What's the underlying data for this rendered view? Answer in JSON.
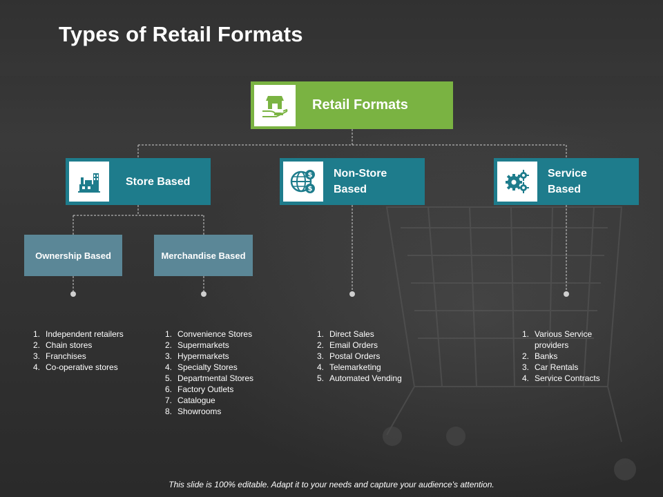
{
  "slide": {
    "title": "Types of Retail Formats",
    "footer": "This slide is 100% editable. Adapt it to your needs and capture your audience's attention."
  },
  "colors": {
    "root_box": "#7ab342",
    "category_box": "#1e7c8c",
    "sub_box": "#5b8797",
    "connector": "#cfcfcf"
  },
  "root": {
    "label": "Retail Formats",
    "icon": "shop-in-hand-icon"
  },
  "categories": [
    {
      "label": "Store Based",
      "icon": "factory-building-icon"
    },
    {
      "label_line1": "Non-Store",
      "label_line2": "Based",
      "icon": "globe-dollar-icon"
    },
    {
      "label_line1": "Service",
      "label_line2": "Based",
      "icon": "gears-icon"
    }
  ],
  "store_subtypes": [
    {
      "label": "Ownership Based"
    },
    {
      "label": "Merchandise Based"
    }
  ],
  "lists": {
    "ownership": [
      {
        "n": "1.",
        "text": "Independent  retailers"
      },
      {
        "n": "2.",
        "text": "Chain stores"
      },
      {
        "n": "3.",
        "text": "Franchises"
      },
      {
        "n": "4.",
        "text": "Co-operative  stores"
      }
    ],
    "merchandise": [
      {
        "n": "1.",
        "text": "Convenience  Stores"
      },
      {
        "n": "2.",
        "text": "Supermarkets"
      },
      {
        "n": "3.",
        "text": "Hypermarkets"
      },
      {
        "n": "4.",
        "text": "Specialty Stores"
      },
      {
        "n": "5.",
        "text": "Departmental Stores"
      },
      {
        "n": "6.",
        "text": "Factory Outlets"
      },
      {
        "n": "7.",
        "text": "Catalogue"
      },
      {
        "n": "8.",
        "text": "Showrooms"
      }
    ],
    "non_store": [
      {
        "n": "1.",
        "text": "Direct Sales"
      },
      {
        "n": "2.",
        "text": "Email Orders"
      },
      {
        "n": "3.",
        "text": "Postal Orders"
      },
      {
        "n": "4.",
        "text": "Telemarketing"
      },
      {
        "n": "5.",
        "text": "Automated Vending"
      }
    ],
    "service": [
      {
        "n": "1.",
        "text": "Various Service providers"
      },
      {
        "n": "2.",
        "text": "Banks"
      },
      {
        "n": "3.",
        "text": "Car Rentals"
      },
      {
        "n": "4.",
        "text": "Service Contracts"
      }
    ]
  }
}
